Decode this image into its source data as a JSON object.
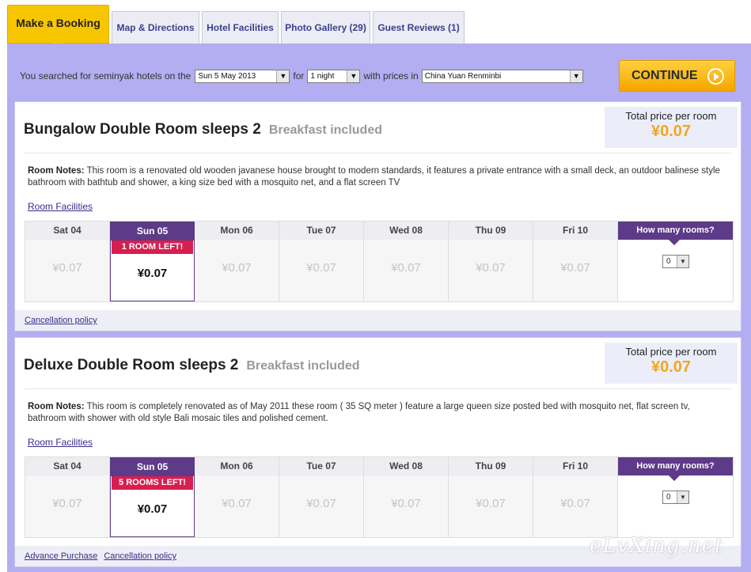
{
  "tabs": [
    {
      "label": "Make a Booking",
      "active": true
    },
    {
      "label": "Map & Directions"
    },
    {
      "label": "Hotel Facilities"
    },
    {
      "label": "Photo Gallery (29)"
    },
    {
      "label": "Guest Reviews (1)"
    }
  ],
  "search": {
    "prefix": "You searched for seminyak hotels on the",
    "date": "Sun 5 May 2013",
    "for_label": "for",
    "nights": "1 night",
    "prices_label": "with prices in",
    "currency": "China Yuan Renminbi"
  },
  "continue_label": "CONTINUE",
  "days": [
    "Sat 04",
    "Sun 05",
    "Mon 06",
    "Tue 07",
    "Wed 08",
    "Thu 09",
    "Fri 10"
  ],
  "rooms": [
    {
      "title": "Bungalow Double Room sleeps 2",
      "breakfast": "Breakfast included",
      "total_label": "Total price per room",
      "total_price": "¥0.07",
      "notes_label": "Room Notes:",
      "notes": "This room is a renovated old wooden javanese house brought to modern standards, it features a private entrance with a small deck, an outdoor balinese style bathroom with bathtub and shower, a king size bed with a mosquito net, and a flat screen TV",
      "facilities_link": "Room Facilities",
      "rooms_left": "1 ROOM LEFT!",
      "prices": [
        "¥0.07",
        "¥0.07",
        "¥0.07",
        "¥0.07",
        "¥0.07",
        "¥0.07",
        "¥0.07"
      ],
      "how_many_label": "How many rooms?",
      "qty": "0",
      "footer_links": [
        "Cancellation policy"
      ]
    },
    {
      "title": "Deluxe Double Room sleeps 2",
      "breakfast": "Breakfast included",
      "total_label": "Total price per room",
      "total_price": "¥0.07",
      "notes_label": "Room Notes:",
      "notes": "This room is completely renovated as of May 2011 these room ( 35 SQ meter ) feature a large queen size posted bed with mosquito net, flat screen tv, bathroom with shower with old style Bali mosaic tiles and polished cement.",
      "facilities_link": "Room Facilities",
      "rooms_left": "5 ROOMS LEFT!",
      "prices": [
        "¥0.07",
        "¥0.07",
        "¥0.07",
        "¥0.07",
        "¥0.07",
        "¥0.07",
        "¥0.07"
      ],
      "how_many_label": "How many rooms?",
      "qty": "0",
      "footer_links": [
        "Advance Purchase",
        "Cancellation policy"
      ]
    }
  ],
  "watermark": "eLvXing.net",
  "colors": {
    "accent": "#f7c600",
    "frame": "#b3adf2",
    "purple": "#5d3b88",
    "alert": "#d71f4f",
    "price": "#f3a51c"
  }
}
